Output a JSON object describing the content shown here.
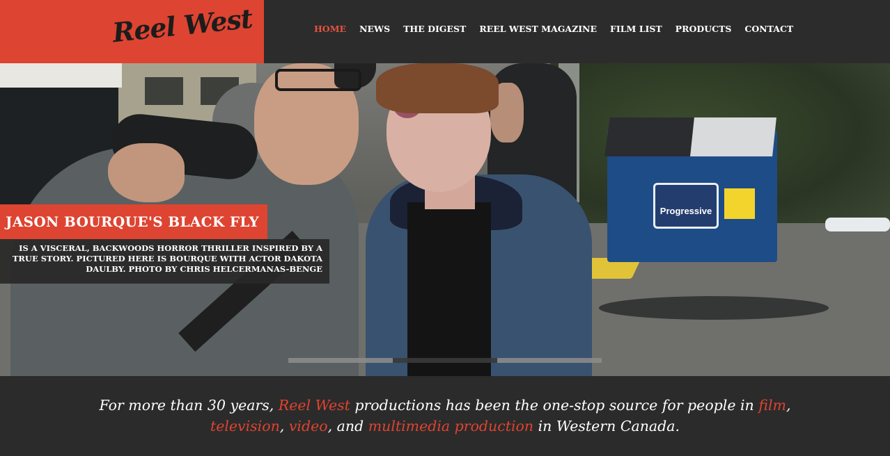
{
  "header": {
    "logo_text": "Reel West",
    "nav": [
      {
        "label": "HOME",
        "active": true
      },
      {
        "label": "NEWS",
        "active": false
      },
      {
        "label": "THE DIGEST",
        "active": false
      },
      {
        "label": "REEL WEST MAGAZINE",
        "active": false
      },
      {
        "label": "FILM LIST",
        "active": false
      },
      {
        "label": "PRODUCTS",
        "active": false
      },
      {
        "label": "CONTACT",
        "active": false
      }
    ]
  },
  "hero": {
    "photo_sign_text": "Progressive",
    "caption_title": "JASON BOURQUE'S BLACK FLY",
    "caption_body": "IS A VISCERAL, BACKWOODS HORROR THRILLER INSPIRED BY A TRUE STORY. PICTURED HERE IS BOURQUE WITH ACTOR DAKOTA DAULBY. PHOTO BY  CHRIS HELCERMANAS-BENGE",
    "slider": {
      "count": 3,
      "current_index": 1
    }
  },
  "tagline": {
    "line1": [
      {
        "text": "For more than 30 years, ",
        "highlight": false
      },
      {
        "text": "Reel West",
        "highlight": true
      },
      {
        "text": " productions has been the one-stop source for people in ",
        "highlight": false
      },
      {
        "text": "film",
        "highlight": true
      },
      {
        "text": ",",
        "highlight": false
      }
    ],
    "line2": [
      {
        "text": "television",
        "highlight": true
      },
      {
        "text": ", ",
        "highlight": false
      },
      {
        "text": "video",
        "highlight": true
      },
      {
        "text": ", and ",
        "highlight": false
      },
      {
        "text": "multimedia production",
        "highlight": true
      },
      {
        "text": " in Western Canada.",
        "highlight": false
      }
    ]
  },
  "colors": {
    "accent": "#dd4431",
    "header_bg": "#2c2c2c",
    "highlight_text": "#e0432f"
  }
}
